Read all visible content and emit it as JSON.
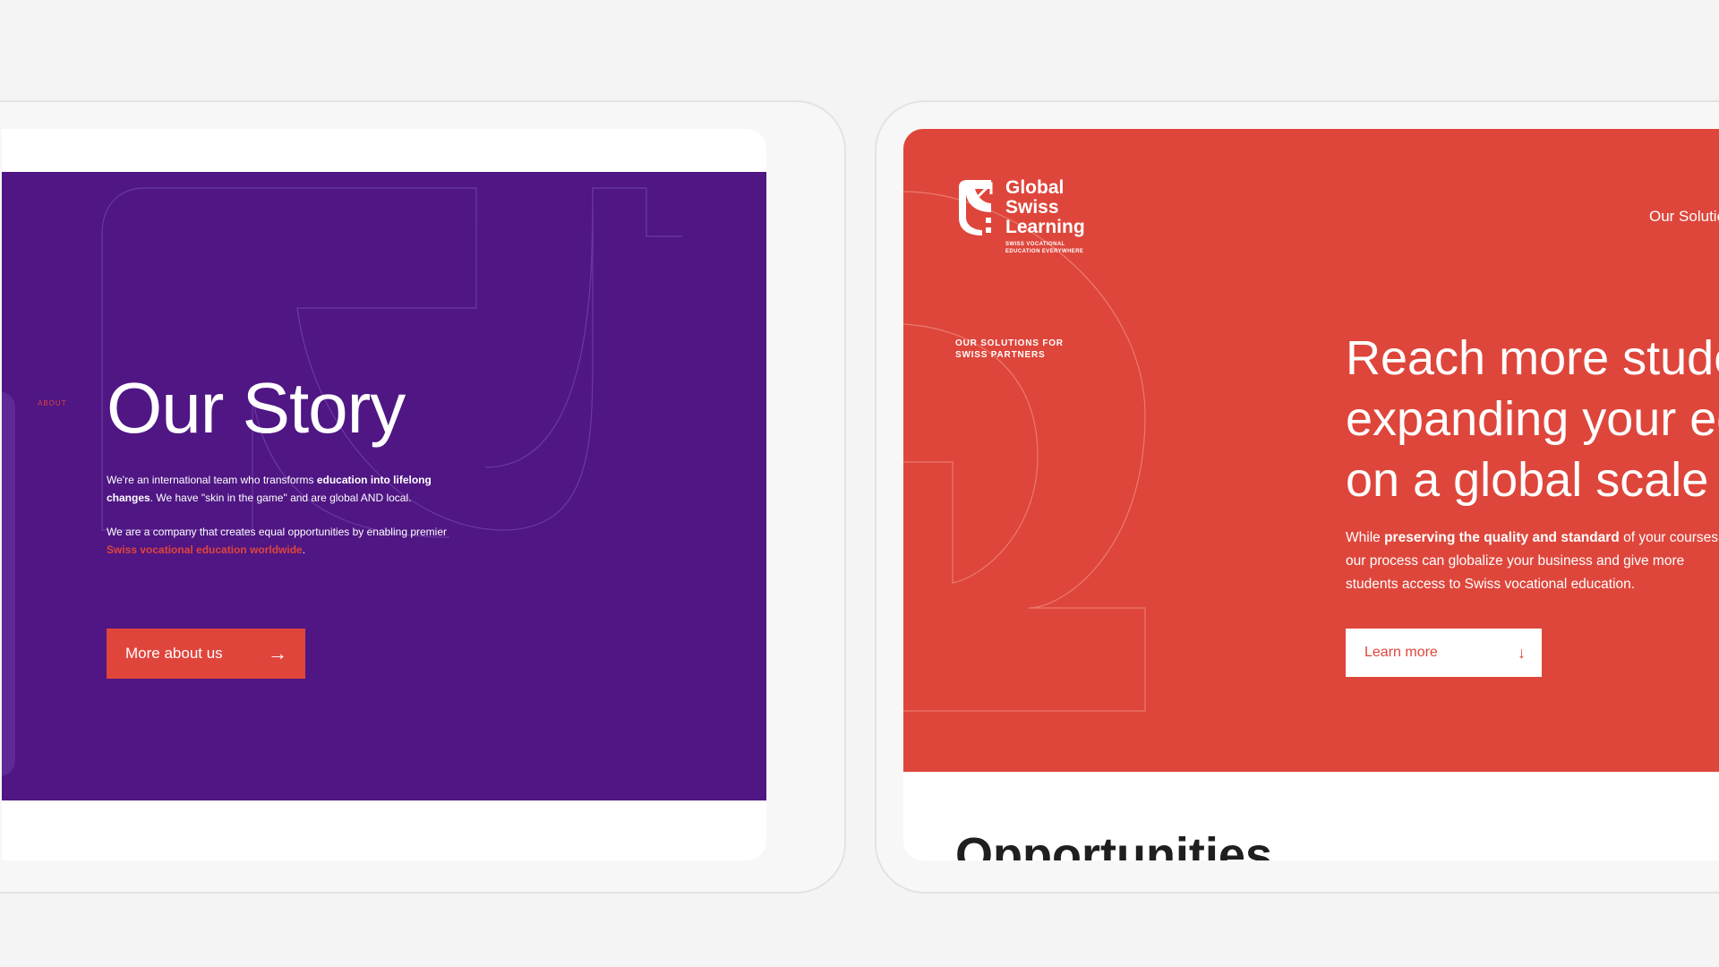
{
  "left_screen": {
    "section_label": "ABOUT",
    "title": "Our Story",
    "para1": {
      "t1": "We're an international team who transforms ",
      "b1": "education into lifelong changes",
      "t2": ". We have \"skin in the game\" and are global AND local."
    },
    "para2": {
      "t1": "We are a company that creates equal opportunities by enabling premier ",
      "hl": "Swiss vocational education worldwide",
      "t2": "."
    },
    "button_label": "More about us",
    "button_icon": "arrow-right-icon"
  },
  "right_screen": {
    "logo": {
      "line1": "Global",
      "line2": "Swiss",
      "line3": "Learning",
      "tag1": "SWISS VOCATIONAL",
      "tag2": "EDUCATION EVERYWHERE"
    },
    "nav_link": "Our Solutions",
    "section_label": {
      "line1": "OUR SOLUTIONS FOR",
      "line2": "SWISS PARTNERS"
    },
    "hero_title": {
      "line1": "Reach more students",
      "line2": "expanding your education",
      "line3": "on a global scale"
    },
    "hero_text": {
      "t1": "While ",
      "b1": "preserving the quality and standard",
      "t2": " of your courses, our process can globalize your business and give more students access to Swiss vocational education."
    },
    "button_label": "Learn more",
    "button_icon": "arrow-down-icon",
    "below_title": "Opportunities"
  },
  "colors": {
    "purple": "#4f1684",
    "red": "#de463b",
    "background": "#f4f4f4"
  }
}
